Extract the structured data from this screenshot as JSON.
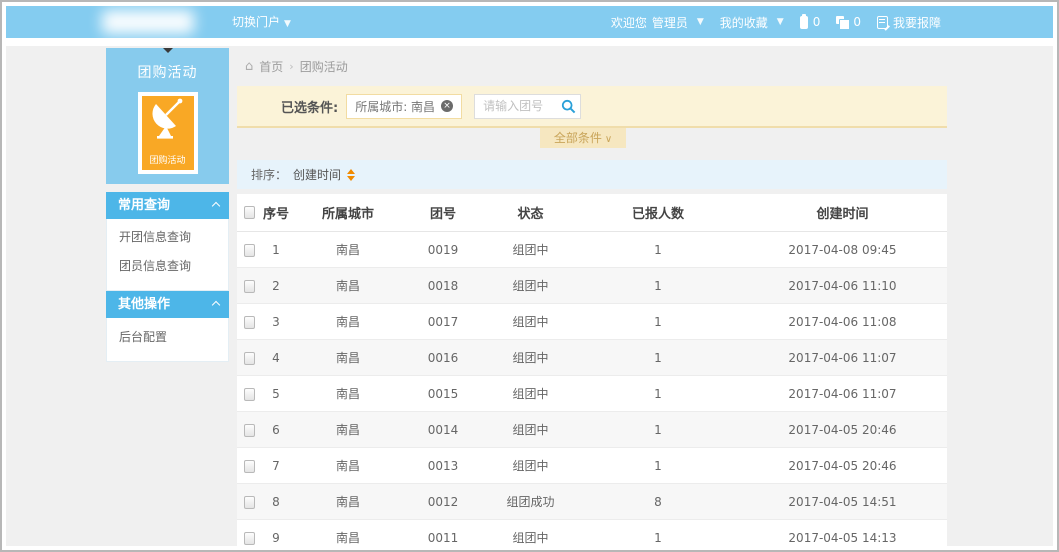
{
  "topbar": {
    "portal_switcher": "切换门户",
    "welcome": "欢迎您",
    "username": "管理员",
    "favorites": "我的收藏",
    "task_count": "0",
    "message_count": "0",
    "report_label": "我要报障"
  },
  "sidebar": {
    "app_title": "团购活动",
    "app_icon_label": "团购活动",
    "sections": [
      {
        "title": "常用查询",
        "items": [
          "开团信息查询",
          "团员信息查询"
        ]
      },
      {
        "title": "其他操作",
        "items": [
          "后台配置"
        ]
      }
    ]
  },
  "breadcrumb": {
    "home": "首页",
    "current": "团购活动"
  },
  "filter": {
    "label": "已选条件:",
    "tag": "所属城市: 南昌",
    "search_placeholder": "请输入团号",
    "all_conditions": "全部条件"
  },
  "sort": {
    "label": "排序：",
    "field": "创建时间"
  },
  "table": {
    "headers": [
      "序号",
      "所属城市",
      "团号",
      "状态",
      "已报人数",
      "创建时间"
    ],
    "rows": [
      [
        "1",
        "南昌",
        "0019",
        "组团中",
        "1",
        "2017-04-08 09:45"
      ],
      [
        "2",
        "南昌",
        "0018",
        "组团中",
        "1",
        "2017-04-06 11:10"
      ],
      [
        "3",
        "南昌",
        "0017",
        "组团中",
        "1",
        "2017-04-06 11:08"
      ],
      [
        "4",
        "南昌",
        "0016",
        "组团中",
        "1",
        "2017-04-06 11:07"
      ],
      [
        "5",
        "南昌",
        "0015",
        "组团中",
        "1",
        "2017-04-06 11:07"
      ],
      [
        "6",
        "南昌",
        "0014",
        "组团中",
        "1",
        "2017-04-05 20:46"
      ],
      [
        "7",
        "南昌",
        "0013",
        "组团中",
        "1",
        "2017-04-05 20:46"
      ],
      [
        "8",
        "南昌",
        "0012",
        "组团成功",
        "8",
        "2017-04-05 14:51"
      ],
      [
        "9",
        "南昌",
        "0011",
        "组团中",
        "1",
        "2017-04-05 14:13"
      ]
    ]
  },
  "colors": {
    "topbar_blue": "#84ccf0",
    "panel_blue": "#87cbed",
    "section_blue": "#4db6e8",
    "icon_orange": "#f9a825",
    "filter_cream": "#fbf3d8",
    "sort_bar_blue": "#e7f3fb",
    "sort_arrow_orange": "#f08a00"
  }
}
